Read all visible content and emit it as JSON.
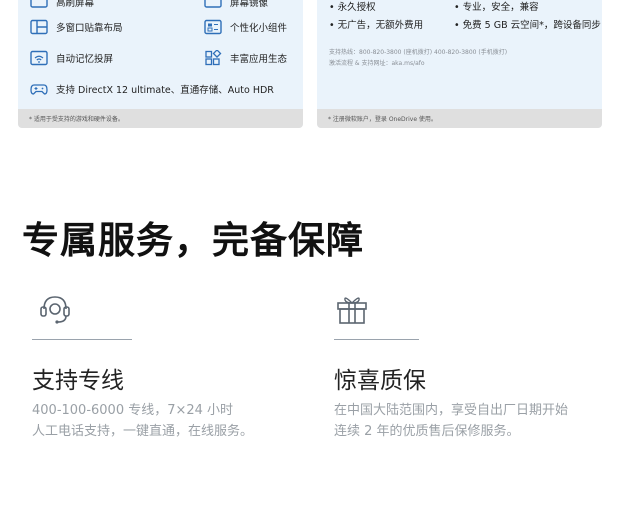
{
  "left_card": {
    "features": [
      {
        "icon": "screen-icon",
        "label": "高刷屏幕"
      },
      {
        "icon": "window-layout-icon",
        "label": "屏幕镜像"
      },
      {
        "icon": "snap-layout-icon",
        "label": "多窗口贴靠布局"
      },
      {
        "icon": "widgets-icon",
        "label": "个性化小组件"
      },
      {
        "icon": "wifi-display-icon",
        "label": "自动记忆投屏"
      },
      {
        "icon": "apps-grid-icon",
        "label": "丰富应用生态"
      },
      {
        "icon": "gamepad-icon",
        "label": "支持 DirectX 12 ultimate、直通存储、Auto HDR"
      }
    ],
    "footnote": "* 适用于受支持的游戏和硬件设备。"
  },
  "right_card": {
    "bullets": [
      "永久授权",
      "专业，安全，兼容",
      "无广告，无额外费用",
      "免费 5 GB 云空间*，跨设备同步"
    ],
    "hotline": "支持热线：800-820-3800 (座机拨打)    400-820-3800 (手机拨打)",
    "activation": "激活流程 & 支持网址：aka.ms/afo",
    "footnote": "* 注册微软账户，登录 OneDrive 使用。"
  },
  "section": {
    "title": "专属服务，完备保障"
  },
  "services": [
    {
      "icon": "headset-icon",
      "title": "支持专线",
      "desc_line1": "400-100-6000 专线，7×24 小时",
      "desc_line2": "人工电话支持，一键直通，在线服务。"
    },
    {
      "icon": "gift-icon",
      "title": "惊喜质保",
      "desc_line1": "在中国大陆范围内，享受自出厂日期开始",
      "desc_line2": "连续 2 年的优质售后保修服务。"
    }
  ],
  "colors": {
    "card_bg": "#eaf3fb",
    "icon_blue": "#2f6fb8",
    "footnote_bg": "#dfdfdf"
  }
}
